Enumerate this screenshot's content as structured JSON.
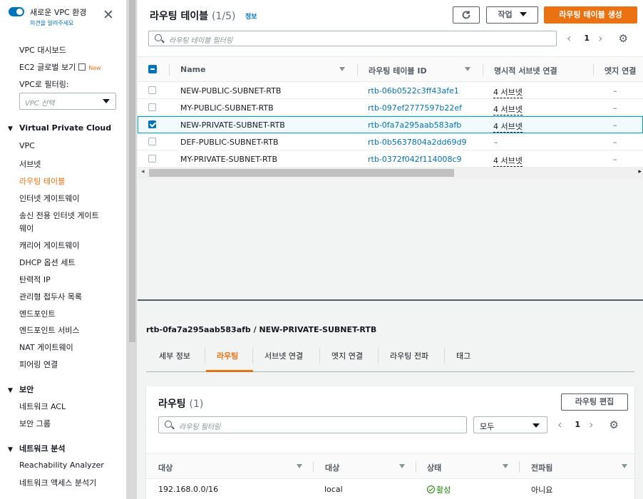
{
  "sidebar": {
    "toggle_title": "새로운 VPC 환경",
    "toggle_sub": "의견을 알려주세요",
    "vpc_dashboard": "VPC 대시보드",
    "ec2_global": "EC2 글로벌 보기",
    "new_badge": "New",
    "filter_label": "VPC로 필터링:",
    "filter_placeholder": "VPC 선택",
    "section_vpc": "Virtual Private Cloud",
    "items_vpc": [
      "VPC",
      "서브넷",
      "라우팅 테이블",
      "인터넷 게이트웨이",
      "송신 전용 인터넷 게이트",
      "웨이",
      "캐리어 게이트웨이",
      "DHCP 옵션 세트",
      "탄력적 IP",
      "관리형 접두사 목록",
      "엔드포인트",
      "엔드포인트 서비스",
      "NAT 게이트웨이",
      "피어링 연결"
    ],
    "active_item": "라우팅 테이블",
    "section_security": "보안",
    "items_security": [
      "네트워크 ACL",
      "보안 그룹"
    ],
    "section_analysis": "네트워크 분석",
    "items_analysis": [
      "Reachability Analyzer",
      "네트워크 액세스 분석기"
    ]
  },
  "top": {
    "title": "라우팅 테이블",
    "count": "(1/5)",
    "info": "정보",
    "actions_label": "작업",
    "create_label": "라우팅 테이블 생성",
    "search_placeholder": "라우팅 테이블 필터링",
    "page": "1",
    "columns": [
      "Name",
      "라우팅 테이블 ID",
      "명시적 서브넷 연결",
      "엣지 연결"
    ],
    "rows": [
      {
        "name": "NEW-PUBLIC-SUBNET-RTB",
        "id": "rtb-06b0522c3ff43afe1",
        "subnets": "4 서브넷",
        "edge": "–",
        "checked": false
      },
      {
        "name": "MY-PUBLIC-SUBNET-RTB",
        "id": "rtb-097ef2777597b22ef",
        "subnets": "4 서브넷",
        "edge": "–",
        "checked": false
      },
      {
        "name": "NEW-PRIVATE-SUBNET-RTB",
        "id": "rtb-0fa7a295aab583afb",
        "subnets": "4 서브넷",
        "edge": "–",
        "checked": true
      },
      {
        "name": "DEF-PUBLIC-SUBNET-RTB",
        "id": "rtb-0b5637804a2dd69d9",
        "subnets": "–",
        "edge": "–",
        "checked": false
      },
      {
        "name": "MY-PRIVATE-SUBNET-RTB",
        "id": "rtb-0372f042f114008c9",
        "subnets": "4 서브넷",
        "edge": "–",
        "checked": false
      }
    ]
  },
  "detail": {
    "title": "rtb-0fa7a295aab583afb / NEW-PRIVATE-SUBNET-RTB",
    "tabs": [
      "세부 정보",
      "라우팅",
      "서브넷 연결",
      "엣지 연결",
      "라우팅 전파",
      "태그"
    ],
    "active_tab": "라우팅",
    "routes_title": "라우팅",
    "routes_count": "(1)",
    "edit_label": "라우팅 편집",
    "search_placeholder": "라우팅 필터링",
    "filter_value": "모두",
    "page": "1",
    "columns": [
      "대상",
      "대상",
      "상태",
      "전파됨"
    ],
    "routes": [
      {
        "destination": "192.168.0.0/16",
        "target": "local",
        "status": "활성",
        "propagated": "아니요"
      }
    ]
  },
  "colors": {
    "accent": "#ec7211",
    "link": "#0073bb",
    "success": "#1d8102"
  }
}
